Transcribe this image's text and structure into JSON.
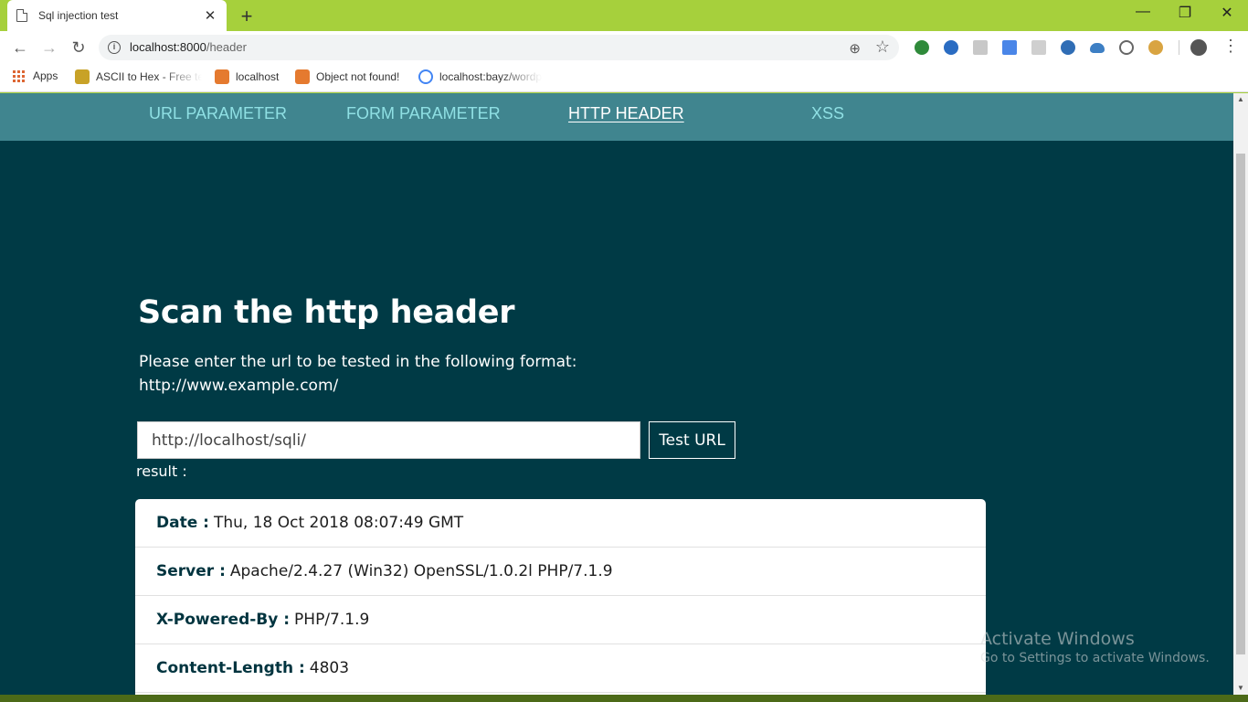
{
  "browser": {
    "tab_title": "Sql injection test",
    "tab_close": "✕",
    "new_tab": "+",
    "url_host": "localhost:8000",
    "url_path": "/header",
    "window_controls": [
      "—",
      "❐",
      "✕"
    ]
  },
  "bookmarks": [
    {
      "label": "Apps"
    },
    {
      "label": "ASCII to Hex - Free te"
    },
    {
      "label": "localhost"
    },
    {
      "label": "Object not found!"
    },
    {
      "label": "localhost:bayz/wordp"
    }
  ],
  "nav": {
    "items": [
      {
        "label": "URL PARAMETER"
      },
      {
        "label": "FORM PARAMETER"
      },
      {
        "label": "HTTP HEADER",
        "active": true
      },
      {
        "label": "XSS"
      }
    ]
  },
  "main": {
    "heading": "Scan the http header",
    "instruction_line1": "Please enter the url to be tested in the following format:",
    "instruction_line2": "http://www.example.com/",
    "input_value": "http://localhost/sqli/",
    "button_label": "Test URL",
    "result_label": "result :"
  },
  "results": [
    {
      "key": "Date :",
      "value": "Thu, 18 Oct 2018 08:07:49 GMT"
    },
    {
      "key": "Server :",
      "value": "Apache/2.4.27 (Win32) OpenSSL/1.0.2l PHP/7.1.9"
    },
    {
      "key": "X-Powered-By :",
      "value": "PHP/7.1.9"
    },
    {
      "key": "Content-Length :",
      "value": "4803"
    }
  ],
  "watermark": {
    "line1": "Activate Windows",
    "line2": "Go to Settings to activate Windows."
  },
  "colors": {
    "chrome_frame": "#a6d03c",
    "page_background": "#003a45",
    "navbar": "#40858f",
    "nav_link": "#8fe0e4"
  }
}
